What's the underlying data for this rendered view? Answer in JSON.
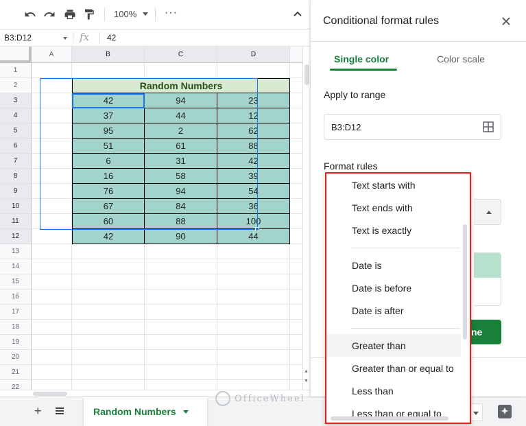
{
  "toolbar": {
    "zoom": "100%",
    "more": "···"
  },
  "formula_bar": {
    "name_box": "B3:D12",
    "fx": "fx",
    "value": "42"
  },
  "grid": {
    "columns": [
      "A",
      "B",
      "C",
      "D"
    ],
    "rows": [
      "1",
      "2",
      "3",
      "4",
      "5",
      "6",
      "7",
      "8",
      "9",
      "10",
      "11",
      "12",
      "13",
      "14",
      "15",
      "16",
      "17",
      "18",
      "19",
      "20",
      "21",
      "22"
    ],
    "title": "Random Numbers",
    "data": [
      [
        42,
        94,
        23
      ],
      [
        37,
        44,
        12
      ],
      [
        95,
        2,
        62
      ],
      [
        51,
        61,
        88
      ],
      [
        6,
        31,
        42
      ],
      [
        16,
        58,
        39
      ],
      [
        76,
        94,
        54
      ],
      [
        67,
        84,
        36
      ],
      [
        60,
        88,
        100
      ],
      [
        42,
        90,
        44
      ]
    ]
  },
  "sheet_tabs": {
    "active": "Random Numbers"
  },
  "watermark": {
    "text": "OfficeWheel"
  },
  "panel": {
    "title": "Conditional format rules",
    "tabs": [
      "Single color",
      "Color scale"
    ],
    "apply_to_range_label": "Apply to range",
    "range_value": "B3:D12",
    "format_rules_label": "Format rules",
    "done_label": "ne"
  },
  "menu": {
    "items": [
      "Text starts with",
      "Text ends with",
      "Text is exactly",
      "Date is",
      "Date is before",
      "Date is after",
      "Greater than",
      "Greater than or equal to",
      "Less than",
      "Less than or equal to"
    ]
  },
  "colors": {
    "accent_green": "#188038",
    "data_fill": "#a2d4cc",
    "title_fill": "#d9ead3",
    "highlight_border": "#e02020",
    "selection_blue": "#1a73e8"
  }
}
